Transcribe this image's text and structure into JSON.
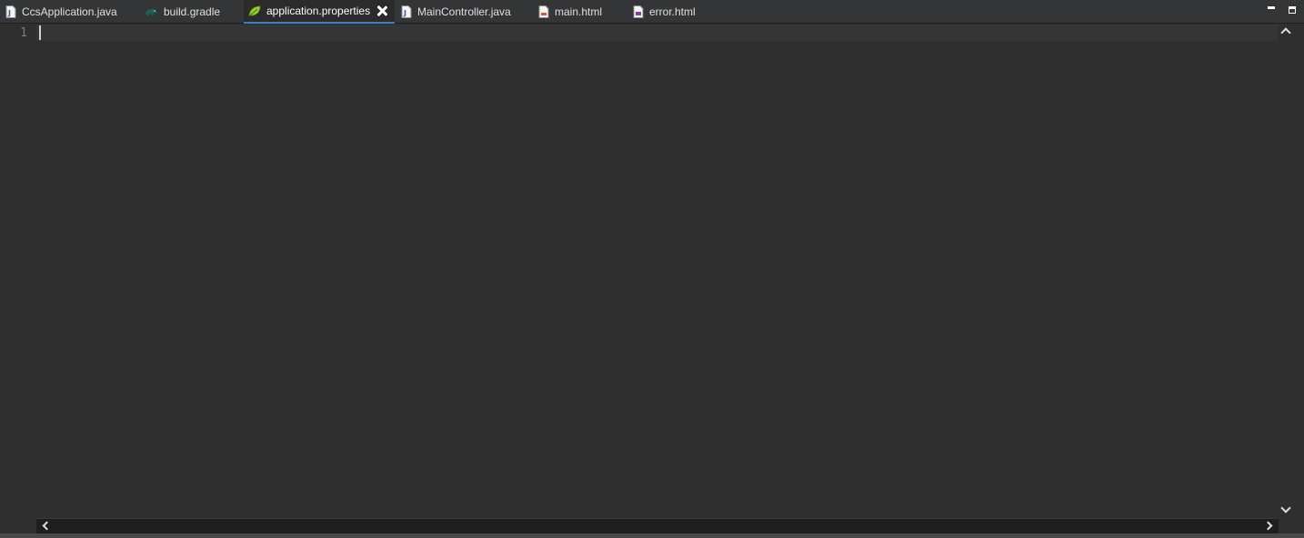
{
  "tabs": [
    {
      "label": "CcsApplication.java",
      "icon": "java-file-icon",
      "active": false
    },
    {
      "label": "build.gradle",
      "icon": "gradle-elephant-icon",
      "active": false
    },
    {
      "label": "application.properties",
      "icon": "spring-leaf-icon",
      "active": true
    },
    {
      "label": "MainController.java",
      "icon": "java-file-icon",
      "active": false
    },
    {
      "label": "main.html",
      "icon": "html-file-icon",
      "active": false
    },
    {
      "label": "error.html",
      "icon": "html-file-icon",
      "active": false
    }
  ],
  "editor": {
    "line_numbers": [
      "1"
    ],
    "content": ""
  },
  "colors": {
    "background": "#2f2f2f",
    "tabbar": "#333537",
    "active_tab_underline": "#3d7db8",
    "current_line": "#353535"
  }
}
